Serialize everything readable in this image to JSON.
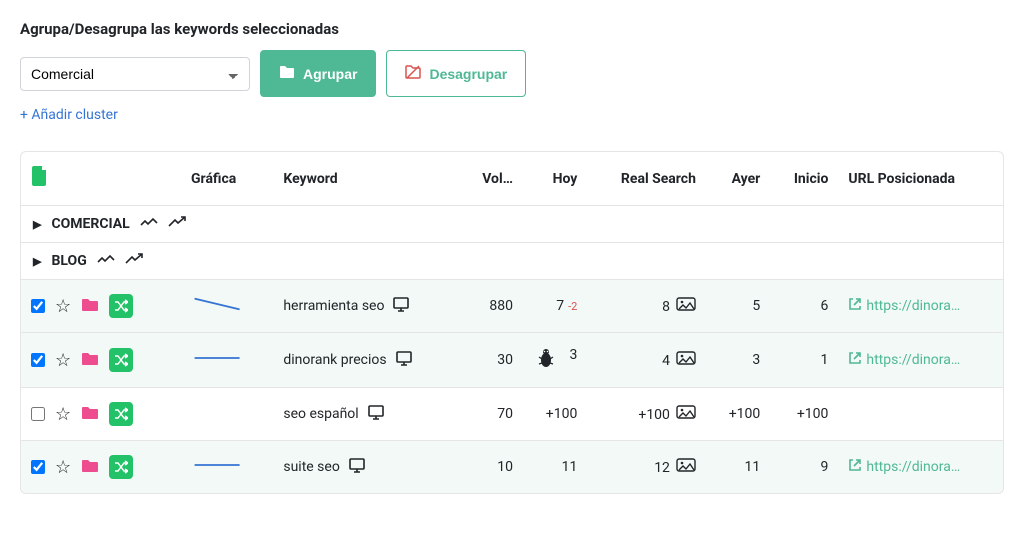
{
  "title": "Agrupa/Desagrupa las keywords seleccionadas",
  "select_value": "Comercial",
  "btn_group": "Agrupar",
  "btn_ungroup": "Desagrupar",
  "add_cluster": "+ Añadir cluster",
  "headers": {
    "grafica": "Gráfica",
    "keyword": "Keyword",
    "volumen": "Vol…",
    "hoy": "Hoy",
    "real": "Real Search",
    "ayer": "Ayer",
    "inicio": "Inicio",
    "url": "URL Posicionada"
  },
  "groups": [
    {
      "name": "COMERCIAL"
    },
    {
      "name": "BLOG"
    }
  ],
  "rows": [
    {
      "checked": true,
      "keyword": "herramienta seo",
      "vol": "880",
      "hoy": "7",
      "delta": "-2",
      "real": "8",
      "ayer": "5",
      "inicio": "6",
      "url": "https://dinora…",
      "spark": true,
      "bug": false,
      "img": true
    },
    {
      "checked": true,
      "keyword": "dinorank precios",
      "vol": "30",
      "hoy": "3",
      "delta": "",
      "real": "4",
      "ayer": "3",
      "inicio": "1",
      "url": "https://dinora…",
      "spark": true,
      "bug": true,
      "img": true
    },
    {
      "checked": false,
      "keyword": "seo español",
      "vol": "70",
      "hoy": "+100",
      "delta": "",
      "real": "+100",
      "ayer": "+100",
      "inicio": "+100",
      "url": "",
      "spark": false,
      "bug": false,
      "img": true
    },
    {
      "checked": true,
      "keyword": "suite seo",
      "vol": "10",
      "hoy": "11",
      "delta": "",
      "real": "12",
      "ayer": "11",
      "inicio": "9",
      "url": "https://dinora…",
      "spark": true,
      "bug": false,
      "img": true
    }
  ]
}
